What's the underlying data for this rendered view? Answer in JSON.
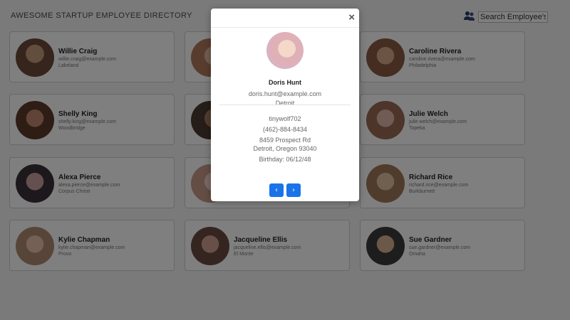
{
  "header": {
    "title": "AWESOME STARTUP EMPLOYEE DIRECTORY",
    "search_placeholder": "Search Employee's",
    "search_icon": "people-search-icon"
  },
  "employees": [
    {
      "name": "Willie Craig",
      "email": "willie.craig@example.com",
      "city": "Lakeland",
      "avatar_color": "#6b4b3a"
    },
    {
      "name": "",
      "email": "",
      "city": "",
      "avatar_color": "#b07a5c"
    },
    {
      "name": "Caroline Rivera",
      "email": "caroline.rivera@example.com",
      "city": "Philadelphia",
      "avatar_color": "#8a5b42"
    },
    {
      "name": "Shelly King",
      "email": "shelly.king@example.com",
      "city": "Woodbridge",
      "avatar_color": "#5a3a2a"
    },
    {
      "name": "",
      "email": "",
      "city": "",
      "avatar_color": "#4a3a30"
    },
    {
      "name": "Julie Welch",
      "email": "julie.welch@example.com",
      "city": "Topeka",
      "avatar_color": "#9a6a55"
    },
    {
      "name": "Alexa Pierce",
      "email": "alexa.pierce@example.com",
      "city": "Corpus Christi",
      "avatar_color": "#3a3038"
    },
    {
      "name": "",
      "email": "",
      "city": "",
      "avatar_color": "#c89a88"
    },
    {
      "name": "Richard Rice",
      "email": "richard.rice@example.com",
      "city": "Burkburnett",
      "avatar_color": "#a07858"
    },
    {
      "name": "Kylie Chapman",
      "email": "kylie.chapman@example.com",
      "city": "Provo",
      "avatar_color": "#b08a72"
    },
    {
      "name": "Jacqueline Ellis",
      "email": "jacqueline.ellis@example.com",
      "city": "El Monte",
      "avatar_color": "#6a4a40"
    },
    {
      "name": "Sue Gardner",
      "email": "sue.gardner@example.com",
      "city": "Omaha",
      "avatar_color": "#3a3a3a"
    }
  ],
  "modal": {
    "close_label": "×",
    "name": "Doris Hunt",
    "email": "doris.hunt@example.com",
    "city": "Detroit",
    "username": "tinywolf702",
    "phone": "(462)-884-8434",
    "street": "8459 Prospect Rd",
    "address": "Detroit, Oregon 93040",
    "birthday": "Birthday: 06/12/48",
    "prev_label": "‹",
    "next_label": "›",
    "avatar_color": "#d8b4c0"
  },
  "colors": {
    "accent": "#1a73e8",
    "overlay": "rgba(0,0,0,0.5)"
  }
}
